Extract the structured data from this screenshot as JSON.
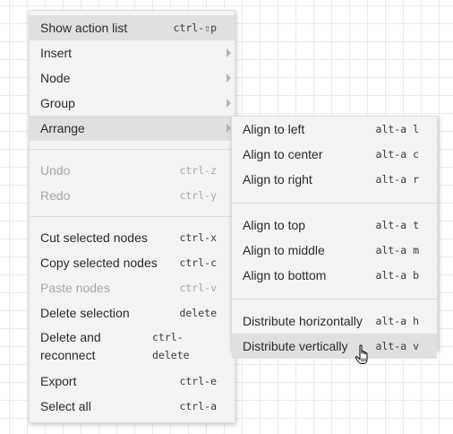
{
  "main_menu": {
    "show_action_list": {
      "label": "Show action list",
      "shortcut": "ctrl-⇧p"
    },
    "insert": {
      "label": "Insert"
    },
    "node": {
      "label": "Node"
    },
    "group": {
      "label": "Group"
    },
    "arrange": {
      "label": "Arrange"
    },
    "undo": {
      "label": "Undo",
      "shortcut": "ctrl-z"
    },
    "redo": {
      "label": "Redo",
      "shortcut": "ctrl-y"
    },
    "cut": {
      "label": "Cut selected nodes",
      "shortcut": "ctrl-x"
    },
    "copy": {
      "label": "Copy selected nodes",
      "shortcut": "ctrl-c"
    },
    "paste": {
      "label": "Paste nodes",
      "shortcut": "ctrl-v"
    },
    "delete_selection": {
      "label": "Delete selection",
      "shortcut": "delete"
    },
    "delete_reconnect": {
      "label": "Delete and reconnect",
      "shortcut": "ctrl-delete"
    },
    "export": {
      "label": "Export",
      "shortcut": "ctrl-e"
    },
    "select_all": {
      "label": "Select all",
      "shortcut": "ctrl-a"
    }
  },
  "arrange_menu": {
    "align_left": {
      "label": "Align to left",
      "shortcut": "alt-a l"
    },
    "align_center": {
      "label": "Align to center",
      "shortcut": "alt-a c"
    },
    "align_right": {
      "label": "Align to right",
      "shortcut": "alt-a r"
    },
    "align_top": {
      "label": "Align to top",
      "shortcut": "alt-a t"
    },
    "align_middle": {
      "label": "Align to middle",
      "shortcut": "alt-a m"
    },
    "align_bottom": {
      "label": "Align to bottom",
      "shortcut": "alt-a b"
    },
    "distribute_h": {
      "label": "Distribute horizontally",
      "shortcut": "alt-a h"
    },
    "distribute_v": {
      "label": "Distribute vertically",
      "shortcut": "alt-a v"
    }
  },
  "colors": {
    "menu_bg": "#f3f3f3",
    "highlight": "#e0e0e0",
    "disabled_text": "#a8a8a8",
    "grid": "#ececec"
  },
  "cursor": {
    "icon": "hand-pointer-icon"
  }
}
